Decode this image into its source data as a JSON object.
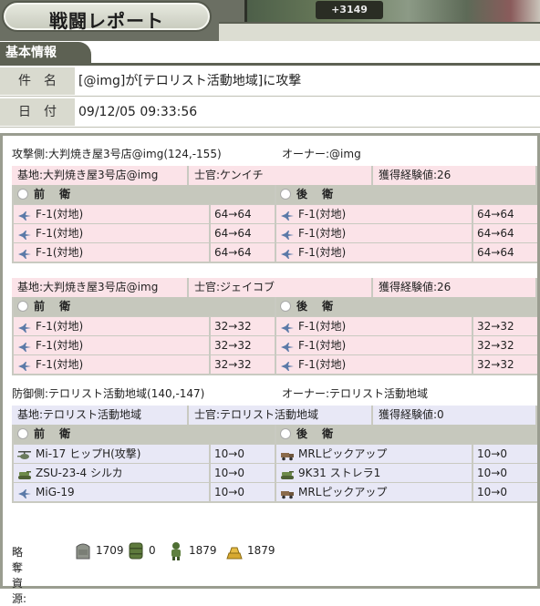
{
  "header": {
    "title": "戦闘レポート",
    "money": "+3149"
  },
  "section_title": "基本情報",
  "info": {
    "subject_label": "件名",
    "subject": "[@img]が[テロリスト活動地域]に攻撃",
    "date_label": "日付",
    "date": "09/12/05 09:33:56"
  },
  "attacker": {
    "side_text": "攻撃側:大判焼き屋3号店@img(124,-155)",
    "owner_text": "オーナー:@img",
    "bases": [
      {
        "base": "基地:大判焼き屋3号店@img",
        "officer": "士官:ケンイチ",
        "exp": "獲得経験値:26",
        "front_label": "前 衛",
        "rear_label": "後 衛",
        "front": [
          {
            "name": "F-1(対地)",
            "count": "64→64",
            "icon": "jet-icon"
          },
          {
            "name": "F-1(対地)",
            "count": "64→64",
            "icon": "jet-icon"
          },
          {
            "name": "F-1(対地)",
            "count": "64→64",
            "icon": "jet-icon"
          }
        ],
        "rear": [
          {
            "name": "F-1(対地)",
            "count": "64→64",
            "icon": "jet-icon"
          },
          {
            "name": "F-1(対地)",
            "count": "64→64",
            "icon": "jet-icon"
          },
          {
            "name": "F-1(対地)",
            "count": "64→64",
            "icon": "jet-icon"
          }
        ]
      },
      {
        "base": "基地:大判焼き屋3号店@img",
        "officer": "士官:ジェイコブ",
        "exp": "獲得経験値:26",
        "front_label": "前 衛",
        "rear_label": "後 衛",
        "front": [
          {
            "name": "F-1(対地)",
            "count": "32→32",
            "icon": "jet-icon"
          },
          {
            "name": "F-1(対地)",
            "count": "32→32",
            "icon": "jet-icon"
          },
          {
            "name": "F-1(対地)",
            "count": "32→32",
            "icon": "jet-icon"
          }
        ],
        "rear": [
          {
            "name": "F-1(対地)",
            "count": "32→32",
            "icon": "jet-icon"
          },
          {
            "name": "F-1(対地)",
            "count": "32→32",
            "icon": "jet-icon"
          },
          {
            "name": "F-1(対地)",
            "count": "32→32",
            "icon": "jet-icon"
          }
        ]
      }
    ]
  },
  "defender": {
    "side_text": "防御側:テロリスト活動地域(140,-147)",
    "owner_text": "オーナー:テロリスト活動地域",
    "base": {
      "base": "基地:テロリスト活動地域",
      "officer": "士官:テロリスト活動地域",
      "exp": "獲得経験値:0",
      "front_label": "前 衛",
      "rear_label": "後 衛",
      "front": [
        {
          "name": "Mi-17 ヒップH(攻撃)",
          "count": "10→0",
          "icon": "helicopter-icon"
        },
        {
          "name": "ZSU-23-4 シルカ",
          "count": "10→0",
          "icon": "tank-icon"
        },
        {
          "name": "MiG-19",
          "count": "10→0",
          "icon": "jet-icon"
        }
      ],
      "rear": [
        {
          "name": "MRLピックアップ",
          "count": "10→0",
          "icon": "truck-icon"
        },
        {
          "name": "9K31 ストレラ1",
          "count": "10→0",
          "icon": "tank-icon"
        },
        {
          "name": "MRLピックアップ",
          "count": "10→0",
          "icon": "truck-icon"
        }
      ]
    }
  },
  "loot": {
    "label": "略奪資源:",
    "items": [
      {
        "icon": "concrete-icon",
        "value": "1709"
      },
      {
        "icon": "oil-barrel-icon",
        "value": "0"
      },
      {
        "icon": "soldier-icon",
        "value": "1879"
      },
      {
        "icon": "gold-bars-icon",
        "value": "1879"
      }
    ]
  },
  "colors": {
    "attacker_bg": "#fbe3e8",
    "defender_bg": "#e8e8f6",
    "frame": "#c9cac1",
    "dark": "#5d6153"
  }
}
